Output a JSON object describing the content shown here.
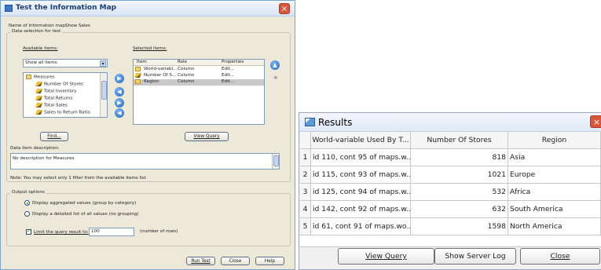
{
  "dialog1": {
    "title": "Test the Information Map",
    "map_name_label": "Name of information map:",
    "map_name_value": "Show Sales",
    "data_selection_label": "Data selection for test",
    "available_items_label": "Available items:",
    "available_filter_value": "Show all items",
    "tree": {
      "root": "Measures",
      "items": [
        "Number Of Stores",
        "Total Inventory",
        "Total Returns",
        "Total Sales",
        "Sales to Return Ratio"
      ]
    },
    "selected_items_label": "Selected items:",
    "selected_columns": [
      "Item",
      "Role",
      "Properties"
    ],
    "selected_rows": [
      {
        "item": "World-variabl...",
        "role": "Column",
        "props": "Edit..."
      },
      {
        "item": "Number Of S...",
        "role": "Column",
        "props": "Edit..."
      },
      {
        "item": "Region",
        "role": "Column",
        "props": "Edit..."
      }
    ],
    "find_button": "Find...",
    "view_query_button": "View Query",
    "description_label": "Data item description:",
    "description_value": "No description for Measures",
    "note": "Note: You may select only 1 filter from the available items list",
    "output_options_label": "Output options",
    "radio_aggregated": "Display aggregated values (group by category)",
    "radio_detailed": "Display a detailed list of all values (no grouping)",
    "limit_label": "Limit the query result to:",
    "limit_value": "100",
    "limit_suffix": "(number of rows)",
    "run_test_button": "Run Test",
    "close_button": "Close",
    "help_button": "Help"
  },
  "dialog2": {
    "title": "Results",
    "columns": [
      "World-variable Used By T...",
      "Number Of Stores",
      "Region"
    ],
    "rows": [
      {
        "n": "1",
        "world": "id 110, cont 95 of maps.w...",
        "stores": "818",
        "region": "Asia"
      },
      {
        "n": "2",
        "world": "id 115, cont 93 of maps.w...",
        "stores": "1021",
        "region": "Europe"
      },
      {
        "n": "3",
        "world": "id 125, cont 94 of maps.w...",
        "stores": "532",
        "region": "Africa"
      },
      {
        "n": "4",
        "world": "id 142, cont 92 of maps.w...",
        "stores": "632",
        "region": "South America"
      },
      {
        "n": "5",
        "world": "id 61, cont 91 of maps.wo...",
        "stores": "1598",
        "region": "North America"
      }
    ],
    "view_query_button": "View Query",
    "show_server_log_button": "Show Server Log",
    "close_button": "Close"
  },
  "icons": [
    "window-icon",
    "close-icon",
    "folder-icon",
    "pencil-icon",
    "arrow-right-icon",
    "arrow-left-icon",
    "arrow-up-icon",
    "arrow-down-icon",
    "results-icon"
  ],
  "colors": {
    "title_blue": "#1c3d72",
    "close_red": "#d8573a",
    "dialog_bg": "#ece9d8",
    "selected_row": "#c9c9c9"
  }
}
